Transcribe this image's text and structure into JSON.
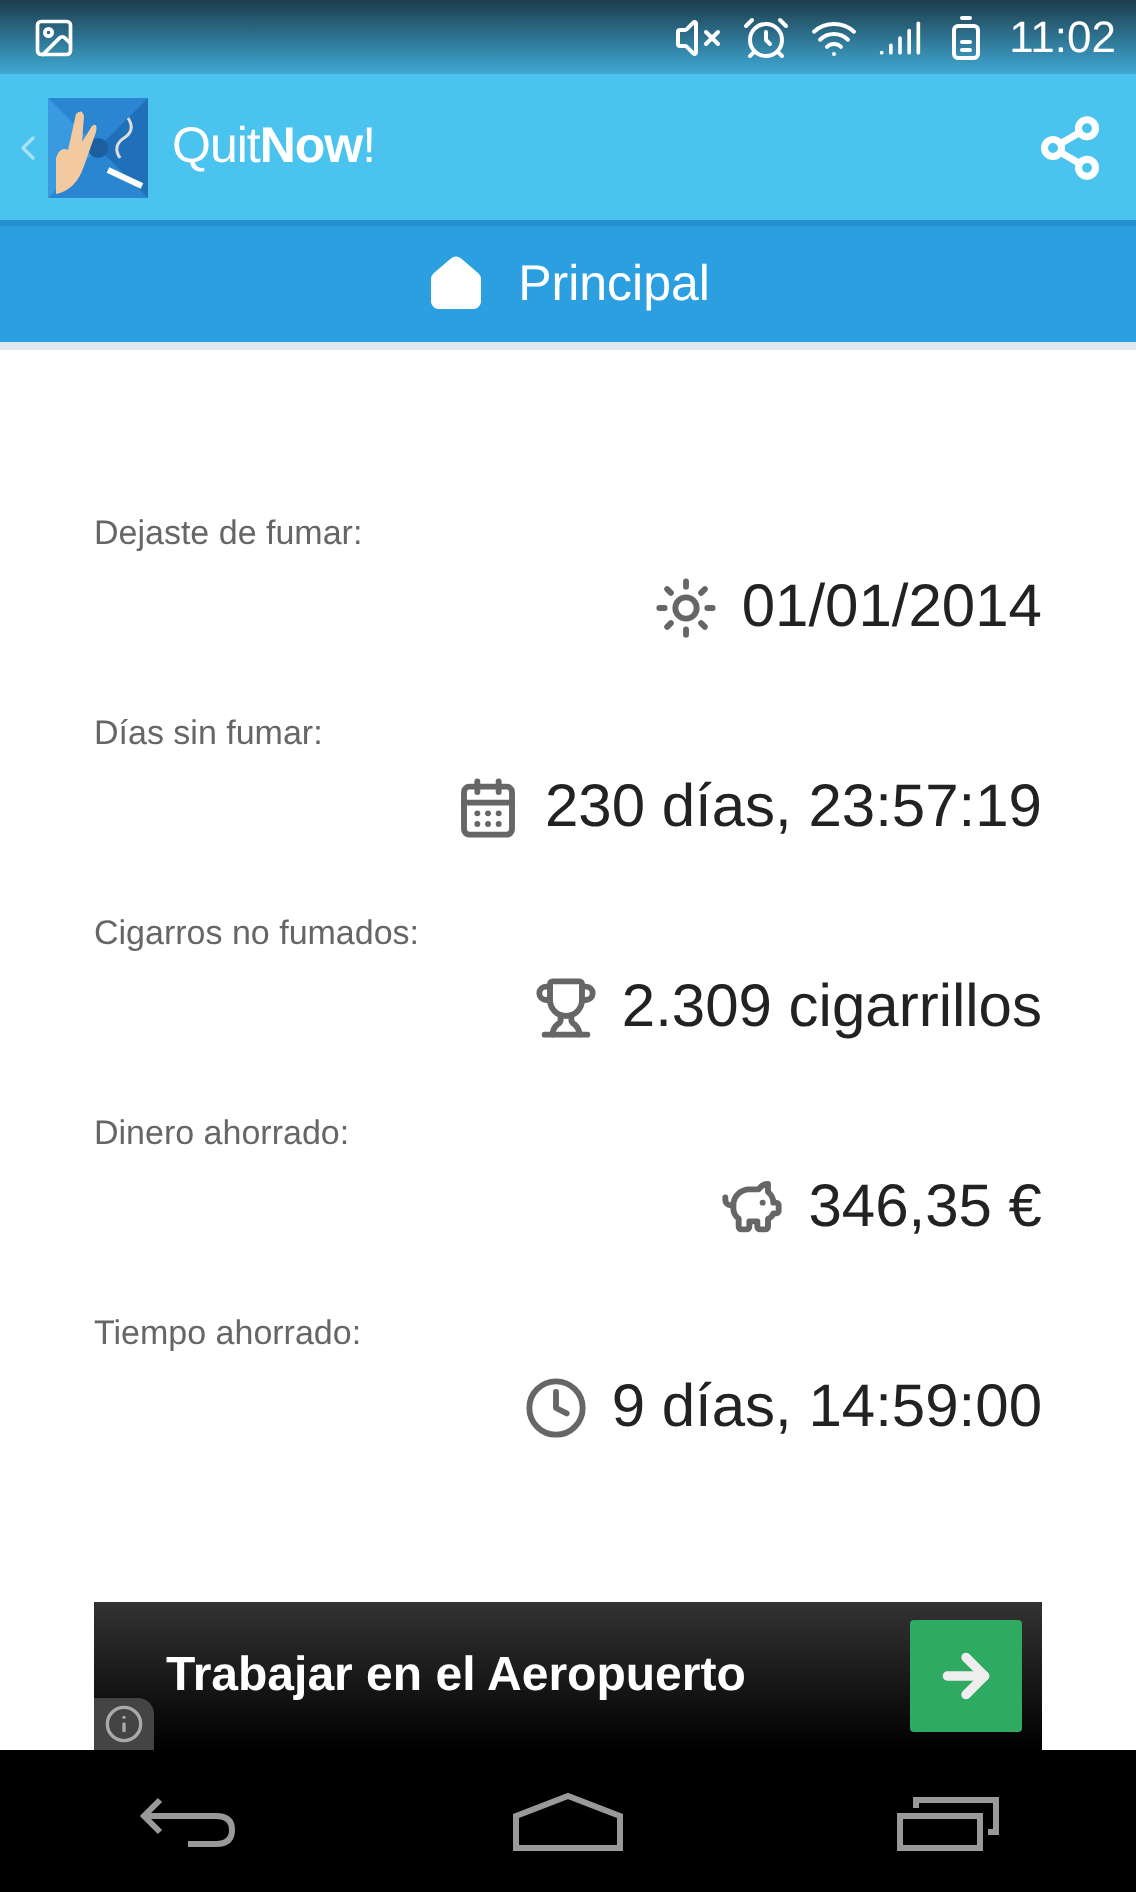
{
  "status_bar": {
    "time": "11:02"
  },
  "app_bar": {
    "title": "Quit**Now**!"
  },
  "section_tab": {
    "label": "Principal"
  },
  "stats": [
    {
      "label": "Dejaste de fumar:",
      "value": "01/01/2014",
      "kind": "sun"
    },
    {
      "label": "Días sin fumar:",
      "value": "230 días, 23:57:19",
      "kind": "calendar"
    },
    {
      "label": "Cigarros no fumados:",
      "value": "2.309 cigarrillos",
      "kind": "trophy"
    },
    {
      "label": "Dinero ahorrado:",
      "value": "346,35 €",
      "kind": "piggy"
    },
    {
      "label": "Tiempo ahorrado:",
      "value": "9 días, 14:59:00",
      "kind": "clock"
    }
  ],
  "ad_banner": {
    "text": "Trabajar en el Aeropuerto"
  }
}
